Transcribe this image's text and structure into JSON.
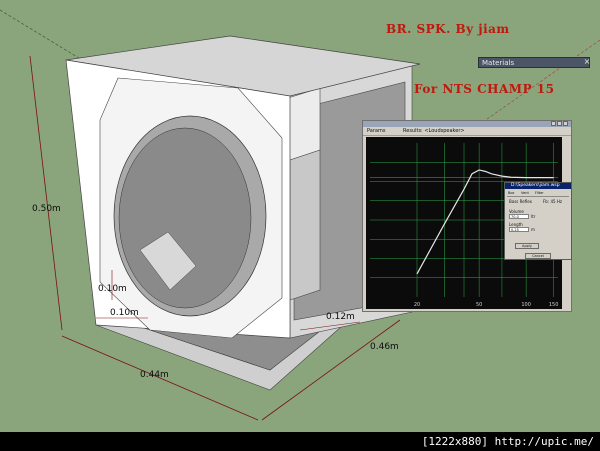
{
  "title": {
    "main": "BR. SPK. By jiam",
    "sub": "For NTS CHAMP 15"
  },
  "materials_panel": {
    "label": "Materials",
    "close_glyph": "×"
  },
  "dimensions": {
    "height": "0.50m",
    "width": "0.44m",
    "depth": "0.46m",
    "port_vertical": "0.10m",
    "port_horizontal": "0.10m",
    "port_width": "0.12m"
  },
  "graph_window": {
    "toolbar": [
      "Params",
      "Results: <Loudspeaker>"
    ],
    "x_ticks": [
      "20",
      "50",
      "100",
      "150"
    ],
    "chart_data": {
      "type": "line",
      "series": [
        {
          "x": [
            20,
            30,
            40,
            45,
            50,
            55,
            60,
            70,
            80,
            100,
            120,
            150
          ],
          "y": [
            -24,
            -11,
            -2,
            2,
            3,
            2.6,
            2,
            1.4,
            1.1,
            1.0,
            1.0,
            1.0
          ]
        }
      ],
      "colors": {
        "background": "#0b0b0b",
        "grid": "#2ba84a",
        "curve": "#e6e6e6",
        "ref": "#d62a2a"
      }
    }
  },
  "dialog": {
    "title": "D:\\Speakers\\jiam.wsp",
    "tabs": [
      "Box",
      "Vent",
      "Filter"
    ],
    "section_vent": "Bass Reflex",
    "section_fb": "Fb: 45 Hz",
    "volume_label": "Volume",
    "volume_value": "70.0",
    "volume_unit": "ltr",
    "length_label": "Length",
    "length_value": "0.25",
    "length_unit": "m",
    "ok": "Apply",
    "close": "Cancel"
  },
  "watermark": "[1222x880] http://upic.me/"
}
